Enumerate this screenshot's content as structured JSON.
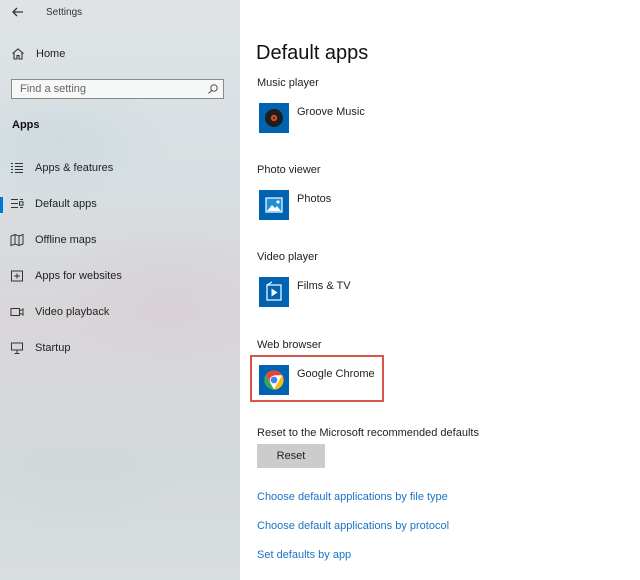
{
  "window": {
    "title": "Settings",
    "back_glyph": "←"
  },
  "sidebar": {
    "home_label": "Home",
    "search_placeholder": "Find a setting",
    "section_title": "Apps",
    "items": [
      {
        "label": "Apps & features",
        "icon": "list-icon",
        "active": false
      },
      {
        "label": "Default apps",
        "icon": "default-apps-icon",
        "active": true
      },
      {
        "label": "Offline maps",
        "icon": "map-icon",
        "active": false
      },
      {
        "label": "Apps for websites",
        "icon": "web-app-icon",
        "active": false
      },
      {
        "label": "Video playback",
        "icon": "video-icon",
        "active": false
      },
      {
        "label": "Startup",
        "icon": "startup-icon",
        "active": false
      }
    ]
  },
  "main": {
    "title": "Default apps",
    "categories": [
      {
        "label": "Music player",
        "app": "Groove Music",
        "icon": "groove-music-icon"
      },
      {
        "label": "Photo viewer",
        "app": "Photos",
        "icon": "photos-icon"
      },
      {
        "label": "Video player",
        "app": "Films & TV",
        "icon": "films-tv-icon"
      },
      {
        "label": "Web browser",
        "app": "Google Chrome",
        "icon": "chrome-icon"
      }
    ],
    "reset": {
      "label": "Reset to the Microsoft recommended defaults",
      "button": "Reset"
    },
    "links": [
      "Choose default applications by file type",
      "Choose default applications by protocol",
      "Set defaults by app"
    ]
  },
  "colors": {
    "accent": "#0078d4",
    "tile": "#0063b1",
    "link": "#1a73c6",
    "highlight": "#d9534f"
  }
}
